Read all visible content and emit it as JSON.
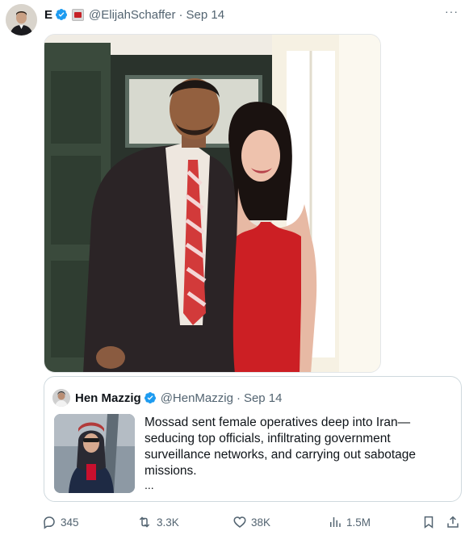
{
  "post": {
    "display_name": "E",
    "handle": "@ElijahSchaffer",
    "separator": "·",
    "date": "Sep 14",
    "more_icon": "more-horizontal-icon",
    "more_label": "···"
  },
  "quote": {
    "display_name": "Hen Mazzig",
    "handle": "@HenMazzig",
    "separator": "·",
    "date": "Sep 14",
    "text": "Mossad sent female operatives deep into Iran—seducing top officials, infiltrating government surveillance networks, and carrying out sabotage missions.",
    "ellipsis": "..."
  },
  "actions": {
    "replies": "345",
    "reposts": "3.3K",
    "likes": "38K",
    "views": "1.5M"
  },
  "colors": {
    "verified": "#1d9bf0",
    "secondary_text": "#536471",
    "border": "#cfd9de",
    "dress": "#cc1f24"
  }
}
